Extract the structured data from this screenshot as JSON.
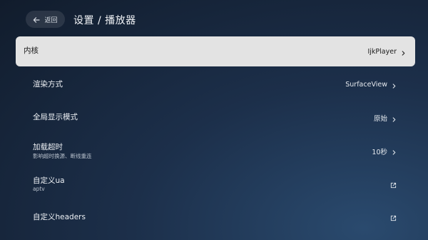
{
  "header": {
    "back_label": "返回",
    "title": "设置 / 播放器"
  },
  "settings": [
    {
      "title": "内核",
      "subtitle": "",
      "value": "IjkPlayer",
      "icon": "chevron-right-icon",
      "focused": true
    },
    {
      "title": "渲染方式",
      "subtitle": "",
      "value": "SurfaceView",
      "icon": "chevron-right-icon"
    },
    {
      "title": "全局显示模式",
      "subtitle": "",
      "value": "原始",
      "icon": "chevron-right-icon"
    },
    {
      "title": "加载超时",
      "subtitle": "影响超时换源、断线重连",
      "value": "10秒",
      "icon": "chevron-right-icon"
    },
    {
      "title": "自定义ua",
      "subtitle": "aptv",
      "value": "",
      "icon": "external-link-icon"
    },
    {
      "title": "自定义headers",
      "subtitle": "",
      "value": "",
      "icon": "external-link-icon"
    }
  ],
  "colors": {
    "focus_background": "#e3e3e3",
    "background_dark": "#111c2c",
    "background_light": "#2a4a6e"
  }
}
